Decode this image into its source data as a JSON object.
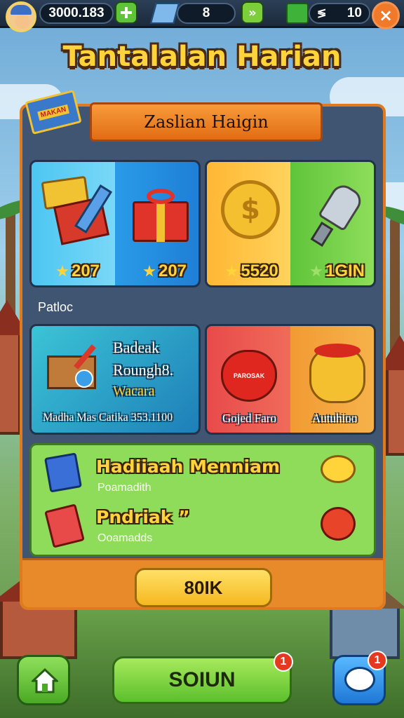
{
  "topbar": {
    "coins": "3000.183",
    "gems": "8",
    "energy": "10",
    "energy_sign": "≶"
  },
  "title": "Tantalalan Harian",
  "panel": {
    "header": "Zaslian Haigin",
    "ticket_label": "MAKAN"
  },
  "rewards": [
    {
      "label": "207",
      "icon": "ticket-rocket-icon"
    },
    {
      "label": "207",
      "icon": "gift-box-icon"
    },
    {
      "label": "5520",
      "icon": "gold-coin-icon"
    },
    {
      "label": "1GIN",
      "icon": "drill-bolt-icon"
    }
  ],
  "section_label": "Patloc",
  "offers": {
    "left": {
      "line1": "Badeak",
      "line2": "Roungh8.",
      "line3": "Wacara",
      "footer": "Madha Mas Catika 353.1100"
    },
    "apple_caption": "Gojed Faro",
    "apple_tag": "PAROSAK",
    "fruit_caption": "Autuhioo"
  },
  "tasks": [
    {
      "title": "Hadiiaah Menniam",
      "sub": "Poamadith",
      "icon": "book-icon",
      "right_icon": "speech-bubble-icon"
    },
    {
      "title": "Pndriak ”",
      "sub": "Ooamadds",
      "icon": "card-icon",
      "right_icon": "tomato-icon"
    }
  ],
  "buttons": {
    "panel_button": "80IK",
    "main": "SOIUN",
    "main_badge": "1",
    "chat_badge": "1"
  },
  "colors": {
    "accent": "#e98a2a",
    "panel": "#3f5572",
    "gold": "#ffd43b"
  }
}
